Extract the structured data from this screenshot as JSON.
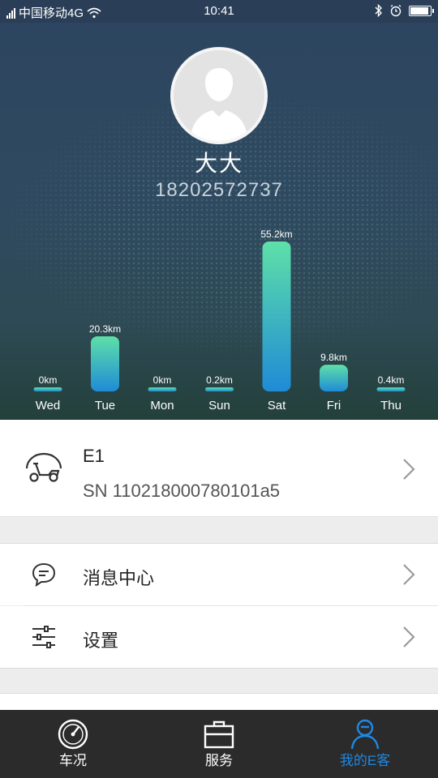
{
  "status_bar": {
    "carrier": "中国移动4G",
    "time": "10:41"
  },
  "profile": {
    "name": "大大",
    "phone": "18202572737"
  },
  "chart_data": {
    "type": "bar",
    "categories": [
      "Wed",
      "Tue",
      "Mon",
      "Sun",
      "Sat",
      "Fri",
      "Thu"
    ],
    "values": [
      0,
      20.3,
      0,
      0.2,
      55.2,
      9.8,
      0.4
    ],
    "labels": [
      "0km",
      "20.3km",
      "0km",
      "0.2km",
      "55.2km",
      "9.8km",
      "0.4km"
    ],
    "unit": "km",
    "ylim": [
      0,
      55.2
    ],
    "colors": {
      "top": "#5ee0a8",
      "bottom": "#1f8bd6"
    }
  },
  "bike": {
    "name": "E1",
    "sn": "SN 110218000780101a5"
  },
  "menu": {
    "messages": "消息中心",
    "settings": "设置"
  },
  "tabs": [
    {
      "label": "车况",
      "icon": "speedometer-icon",
      "active": false
    },
    {
      "label": "服务",
      "icon": "toolbox-icon",
      "active": false
    },
    {
      "label": "我的E客",
      "icon": "user-icon",
      "active": true
    }
  ],
  "colors": {
    "accent": "#1e88e5",
    "header_bg": "#2d4560",
    "tabbar_bg": "#2b2b2b"
  }
}
